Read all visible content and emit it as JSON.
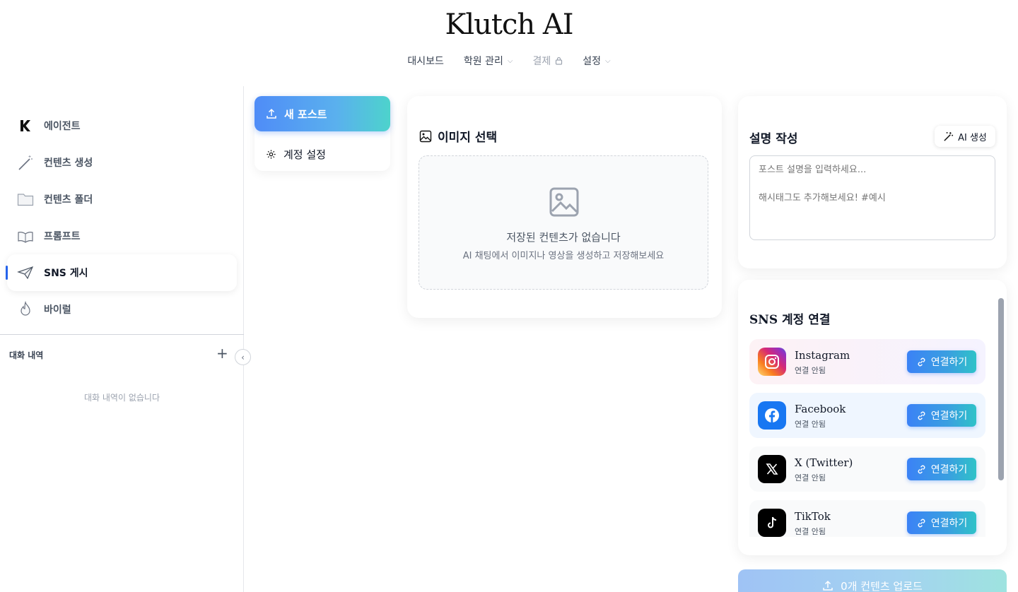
{
  "app": {
    "brand": "Klutch AI"
  },
  "topnav": {
    "dashboard": "대시보드",
    "academy": "학원 관리",
    "payment": "결제",
    "settings": "설정"
  },
  "sidebar": {
    "items": [
      {
        "label": "에이전트",
        "icon": "klutch-logo-icon"
      },
      {
        "label": "컨텐츠 생성",
        "icon": "magic-wand-icon"
      },
      {
        "label": "컨텐츠 폴더",
        "icon": "folder-icon"
      },
      {
        "label": "프롬프트",
        "icon": "open-book-icon"
      },
      {
        "label": "SNS 게시",
        "icon": "paper-plane-icon",
        "active": true
      },
      {
        "label": "바이럴",
        "icon": "flame-icon"
      }
    ],
    "history_title": "대화 내역",
    "history_empty": "대화 내역이 없습니다"
  },
  "submenu": {
    "new_post": "새 포스트",
    "account_settings": "계정 설정"
  },
  "image_select": {
    "title": "이미지 선택",
    "empty_title": "저장된 컨텐츠가 없습니다",
    "empty_sub": "AI 채팅에서 이미지나 영상을 생성하고 저장해보세요"
  },
  "description": {
    "title": "설명 작성",
    "ai_button": "AI 생성",
    "placeholder": "포스트 설명을 입력하세요...\n\n해시태그도 추가해보세요! #예시"
  },
  "sns": {
    "title": "SNS 계정 연결",
    "connect_label": "연결하기",
    "accounts": [
      {
        "name": "Instagram",
        "status": "연결 안됨"
      },
      {
        "name": "Facebook",
        "status": "연결 안됨"
      },
      {
        "name": "X (Twitter)",
        "status": "연결 안됨"
      },
      {
        "name": "TikTok",
        "status": "연결 안됨"
      }
    ]
  },
  "upload": {
    "label": "0개 컨텐츠 업로드"
  },
  "colors": {
    "accent": "#3b82f6",
    "accent_teal": "#2fc2c8",
    "facebook": "#1877f2"
  }
}
